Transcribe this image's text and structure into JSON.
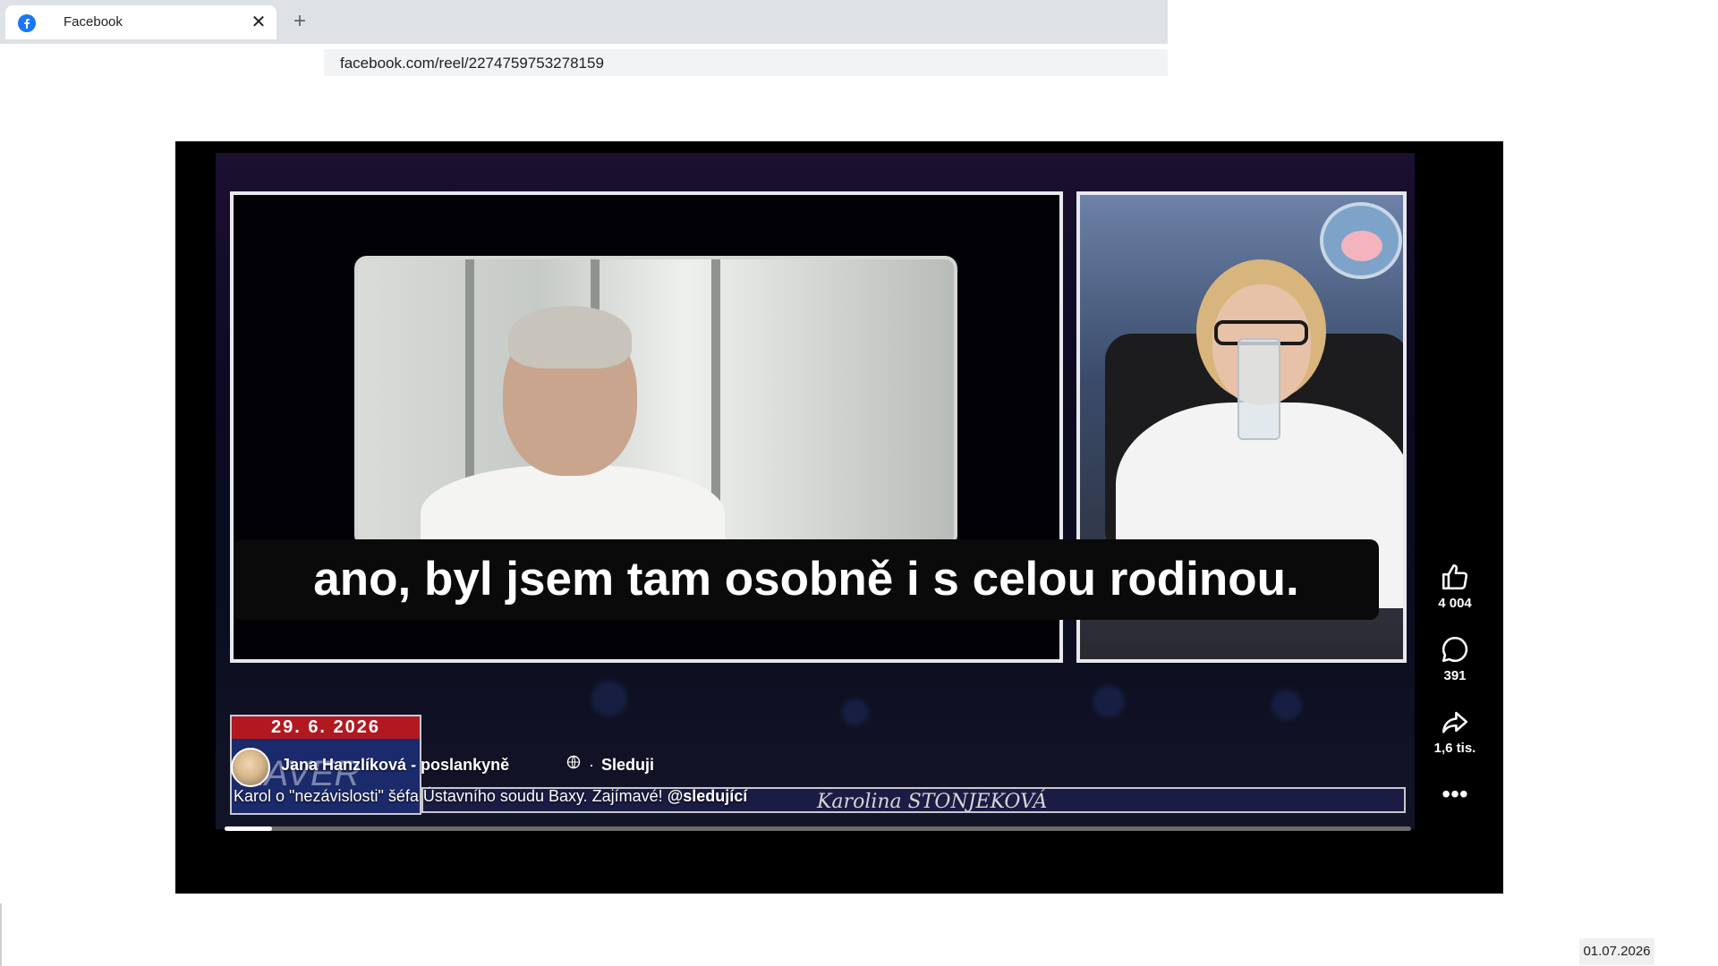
{
  "browser": {
    "tab_title": "Facebook",
    "favicon": "facebook-f-logo",
    "url": "facebook.com/reel/2274759753278159"
  },
  "reel": {
    "subtitle": "ano, byl jsem tam osobně i s celou rodinou.",
    "overlay_date": "29. 6. 2026",
    "overlay_logo_text": "XAVER",
    "presenter_name": "Karolina STONJEKOVÁ",
    "owner": {
      "name": "Jana Hanzlíková - poslankyně",
      "privacy_icon": "globe-icon",
      "separator": "·",
      "follow_label": "Sleduji"
    },
    "caption_text": "Karol o \"nezávislosti\" šéfa Ústavního soudu Baxy. Zajímavé! ",
    "caption_mention": "@sledující",
    "progress": 0.04,
    "actions": {
      "like_count": "4 004",
      "comment_count": "391",
      "share_count": "1,6 tis."
    }
  },
  "footer": {
    "date": "01.07.2026"
  }
}
